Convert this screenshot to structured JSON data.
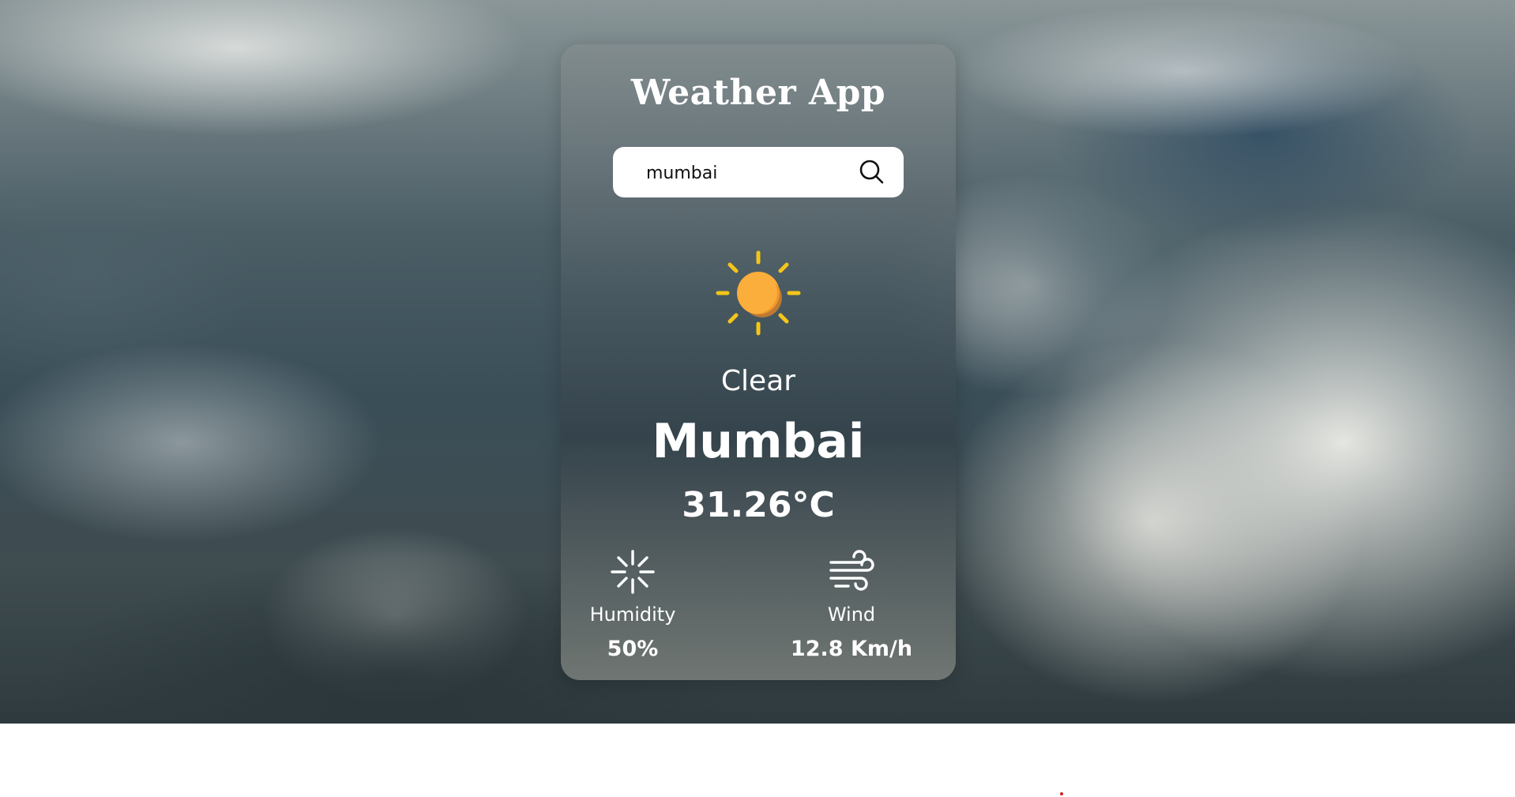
{
  "app": {
    "title": "Weather App",
    "search": {
      "value": "mumbai"
    },
    "icons": {
      "search": "search-icon",
      "weather": "sun-icon",
      "humidity": "humidity-icon",
      "wind": "wind-icon"
    },
    "weather": {
      "condition": "Clear",
      "city": "Mumbai",
      "temperature": "31.26°C"
    },
    "details": {
      "humidity": {
        "label": "Humidity",
        "value": "50%"
      },
      "wind": {
        "label": "Wind",
        "value": "12.8 Km/h"
      }
    }
  },
  "colors": {
    "sun_core": "#FBAE3B",
    "sun_rays": "#F5C518",
    "text": "#FFFFFF",
    "search_bg": "#FFFFFF"
  }
}
